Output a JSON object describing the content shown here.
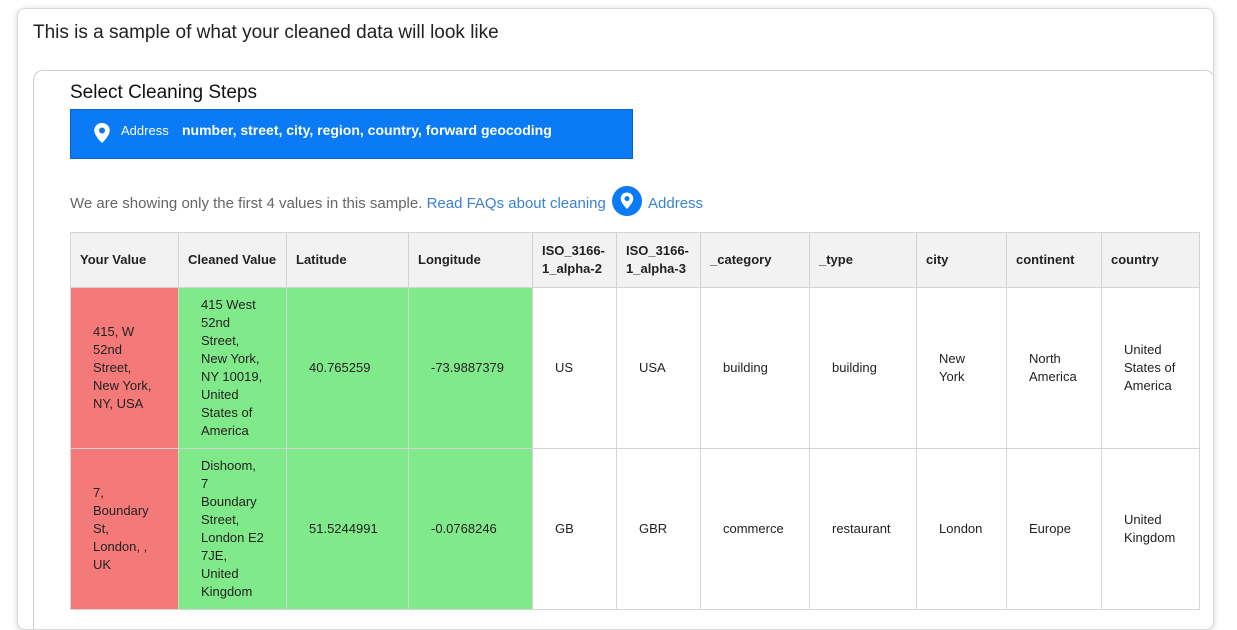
{
  "header": {
    "title": "This is a sample of what your cleaned data will look like"
  },
  "steps": {
    "title": "Select Cleaning Steps",
    "selected": {
      "icon": "map-pin-icon",
      "label": "Address",
      "description": "number, street, city, region, country, forward geocoding"
    },
    "accent_color": "#0a7af5"
  },
  "info": {
    "text": "We are showing only the first 4 values in this sample. ",
    "link": "Read FAQs about cleaning",
    "icon": "map-pin-icon",
    "link_suffix": "Address"
  },
  "table": {
    "columns": [
      "Your Value",
      "Cleaned Value",
      "Latitude",
      "Longitude",
      "ISO_3166-1_alpha-2",
      "ISO_3166-1_alpha-3",
      "_category",
      "_type",
      "city",
      "continent",
      "country"
    ],
    "rows": [
      [
        "415, W 52nd Street, New York, NY, USA",
        "415 West 52nd Street, New York, NY 10019, United States of America",
        "40.765259",
        "-73.9887379",
        "US",
        "USA",
        "building",
        "building",
        "New York",
        "North America",
        "United States of America"
      ],
      [
        "7, Boundary St, London, , UK",
        "Dishoom, 7 Boundary Street, London E2 7JE, United Kingdom",
        "51.5244991",
        "-0.0768246",
        "GB",
        "GBR",
        "commerce",
        "restaurant",
        "London",
        "Europe",
        "United Kingdom"
      ]
    ],
    "colors": {
      "original": "#f47a7a",
      "cleaned": "#80e98a"
    }
  }
}
